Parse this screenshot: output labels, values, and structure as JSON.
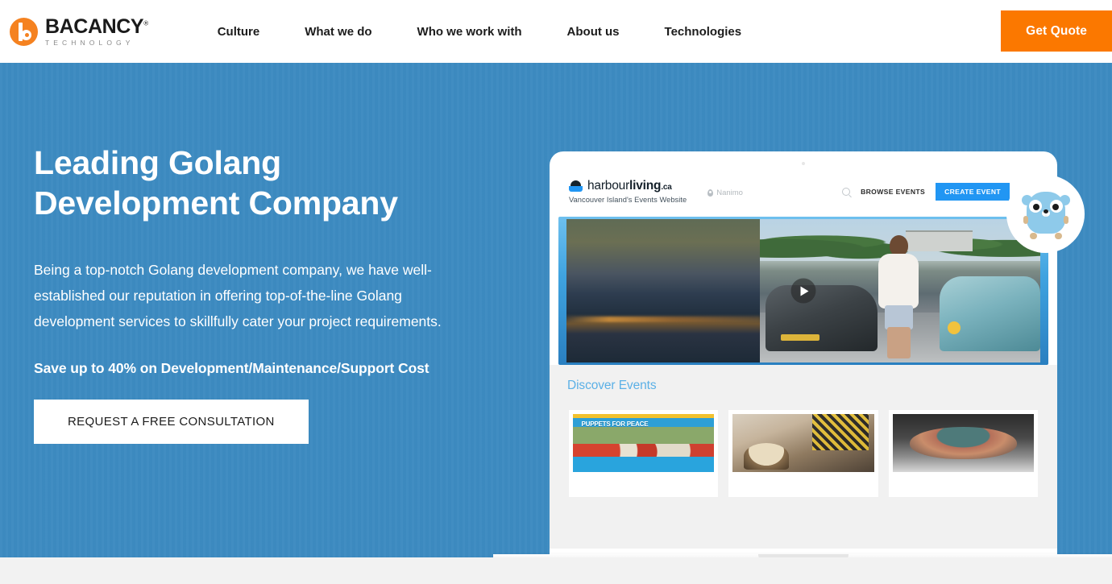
{
  "header": {
    "logo": {
      "name": "BACANCY",
      "registered": "®",
      "sub": "TECHNOLOGY"
    },
    "nav": [
      {
        "label": "Culture"
      },
      {
        "label": "What we do"
      },
      {
        "label": "Who we work with"
      },
      {
        "label": "About us"
      },
      {
        "label": "Technologies"
      }
    ],
    "quote_button": "Get Quote"
  },
  "hero": {
    "title": "Leading Golang Development Company",
    "description": "Being a top-notch Golang development company, we have well-established our reputation in offering top-of-the-line Golang development services to skillfully cater your project requirements.",
    "savings": "Save up to 40% on Development/Maintenance/Support Cost",
    "cta": "REQUEST A FREE CONSULTATION",
    "background_color": "#3d8bc1",
    "mascot": "go-gopher-icon"
  },
  "mockup": {
    "site": {
      "brand_prefix": "harbour",
      "brand_bold": "living",
      "brand_tld": ".ca",
      "tagline": "Vancouver Island's Events Website",
      "location": "Nanimo",
      "nav": {
        "browse": "BROWSE EVENTS",
        "create": "CREATE EVENT",
        "create_color": "#2196f3"
      },
      "hero_media": {
        "play_label": "play-button"
      },
      "section_title": "Discover Events",
      "cards": [
        {
          "name": "puppets-for-peace-event",
          "poster_text": "PUPPETS FOR PEACE"
        },
        {
          "name": "drumming-event",
          "poster_text": ""
        },
        {
          "name": "ceramics-event",
          "poster_text": ""
        }
      ]
    }
  }
}
